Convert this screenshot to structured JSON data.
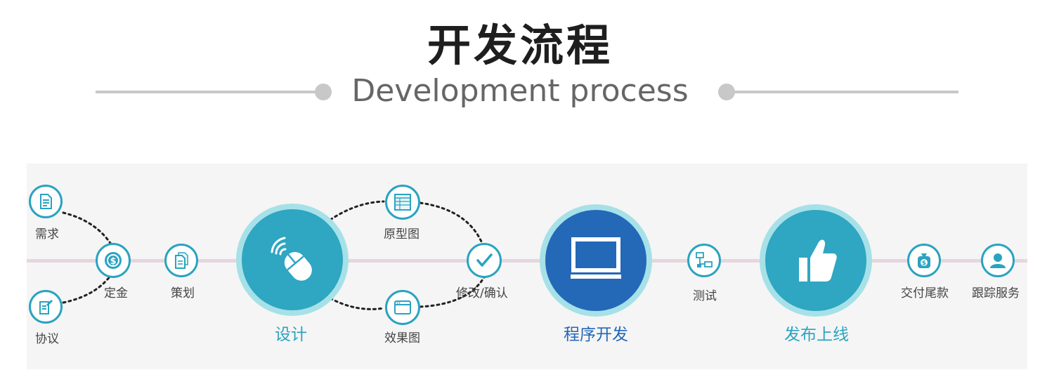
{
  "header": {
    "title": "开发流程",
    "subtitle": "Development process"
  },
  "colors": {
    "accent": "#2aa3c0",
    "accent_dark": "#2468b8",
    "ring": "#a7e1e8",
    "axis": "#e6d6df",
    "panel": "#f5f5f5"
  },
  "steps": {
    "requirement": "需求",
    "agreement": "协议",
    "deposit": "定金",
    "planning": "策划",
    "design": "设计",
    "prototype": "原型图",
    "mockup": "效果图",
    "revise_confirm": "修改/确认",
    "development": "程序开发",
    "testing": "测试",
    "launch": "发布上线",
    "final_payment": "交付尾款",
    "follow_up_service": "跟踪服务"
  },
  "icons": {
    "requirement": "document-icon",
    "agreement": "contract-icon",
    "deposit": "coin-icon",
    "planning": "documents-icon",
    "design": "mouse-icon",
    "prototype": "wireframe-icon",
    "mockup": "browser-window-icon",
    "revise_confirm": "checkmark-icon",
    "development": "monitor-icon",
    "testing": "network-icon",
    "launch": "thumbs-up-icon",
    "final_payment": "money-bag-icon",
    "follow_up_service": "user-icon"
  }
}
